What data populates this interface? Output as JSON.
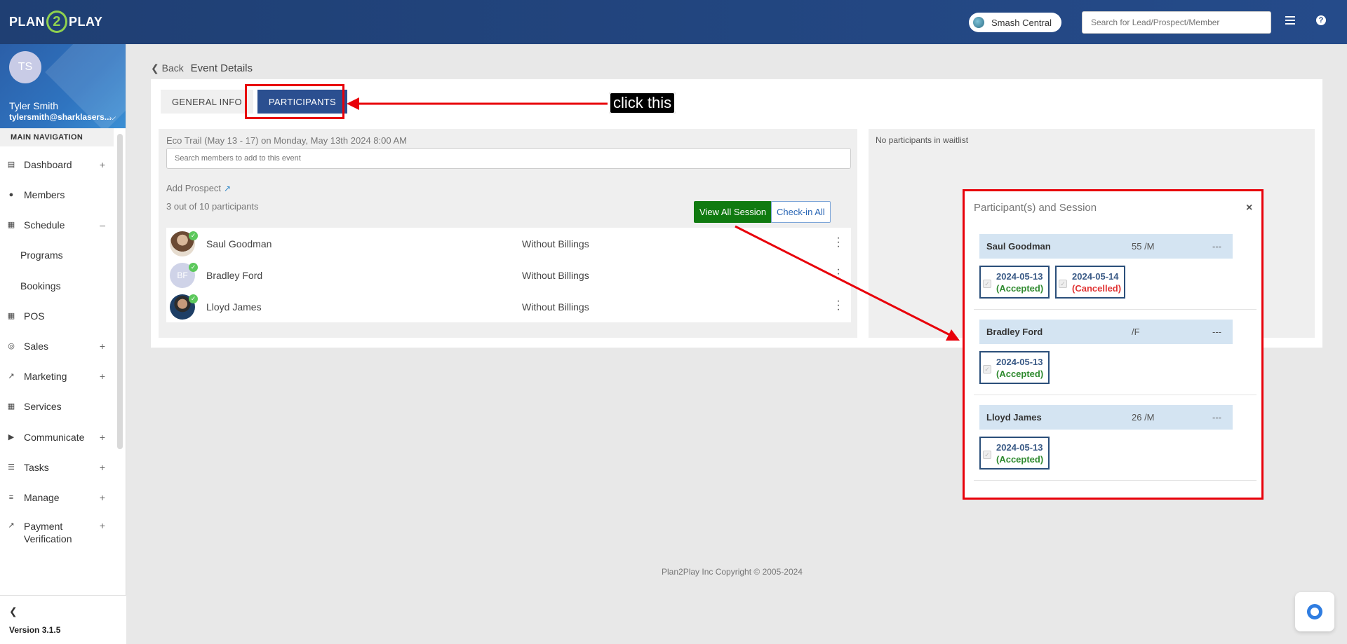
{
  "topbar": {
    "logo_left": "PLAN",
    "logo_mid": "2",
    "logo_right": "PLAY",
    "location": "Smash Central",
    "search_placeholder": "Search for Lead/Prospect/Member"
  },
  "sidebar": {
    "avatar_initials": "TS",
    "user_name": "Tyler Smith",
    "user_email": "tylersmith@sharklasers...",
    "nav_header": "MAIN NAVIGATION",
    "items": [
      {
        "label": "Dashboard",
        "expander": "+"
      },
      {
        "label": "Members",
        "expander": ""
      },
      {
        "label": "Schedule",
        "expander": "–"
      },
      {
        "label": "Programs",
        "expander": ""
      },
      {
        "label": "Bookings",
        "expander": ""
      },
      {
        "label": "POS",
        "expander": ""
      },
      {
        "label": "Sales",
        "expander": "+"
      },
      {
        "label": "Marketing",
        "expander": "+"
      },
      {
        "label": "Services",
        "expander": ""
      },
      {
        "label": "Communicate",
        "expander": "+"
      },
      {
        "label": "Tasks",
        "expander": "+"
      },
      {
        "label": "Manage",
        "expander": "+"
      },
      {
        "label": "Payment",
        "expander": "+"
      },
      {
        "label": "Verification",
        "expander": ""
      }
    ],
    "version": "Version 3.1.5"
  },
  "page": {
    "back_label": "Back",
    "title": "Event Details"
  },
  "tabs": {
    "general": "GENERAL INFO",
    "participants": "PARTICIPANTS"
  },
  "event": {
    "line": "Eco Trail (May 13 - 17) on Monday, May 13th 2024 8:00 AM",
    "search_placeholder": "Search members to add to this event",
    "add_prospect": "Add Prospect",
    "count": "3 out of 10 participants",
    "view_all_btn": "View All Session",
    "checkin_btn": "Check-in All"
  },
  "participants": [
    {
      "name": "Saul Goodman",
      "billing": "Without Billings",
      "initials": ""
    },
    {
      "name": "Bradley Ford",
      "billing": "Without Billings",
      "initials": "BF"
    },
    {
      "name": "Lloyd James",
      "billing": "Without Billings",
      "initials": ""
    }
  ],
  "waitlist": {
    "empty_text": "No participants in waitlist"
  },
  "modal": {
    "title": "Participant(s) and Session",
    "close": "×",
    "people": [
      {
        "name": "Saul Goodman",
        "age": "55 /M",
        "dash": "---",
        "sessions": [
          {
            "date": "2024-05-13",
            "status": "(Accepted)"
          },
          {
            "date": "2024-05-14",
            "status": "(Cancelled)"
          }
        ]
      },
      {
        "name": "Bradley Ford",
        "age": "/F",
        "dash": "---",
        "sessions": [
          {
            "date": "2024-05-13",
            "status": "(Accepted)"
          }
        ]
      },
      {
        "name": "Lloyd James",
        "age": "26 /M",
        "dash": "---",
        "sessions": [
          {
            "date": "2024-05-13",
            "status": "(Accepted)"
          }
        ]
      }
    ]
  },
  "annotation": {
    "callout": "click this"
  },
  "footer": {
    "copyright": "Plan2Play Inc Copyright © 2005-2024"
  },
  "colors": {
    "brand_blue": "#254b8a",
    "accent_green": "#8fd14f",
    "annotation_red": "#e8000a",
    "accepted": "#2f8a2f",
    "cancelled": "#e03333"
  }
}
